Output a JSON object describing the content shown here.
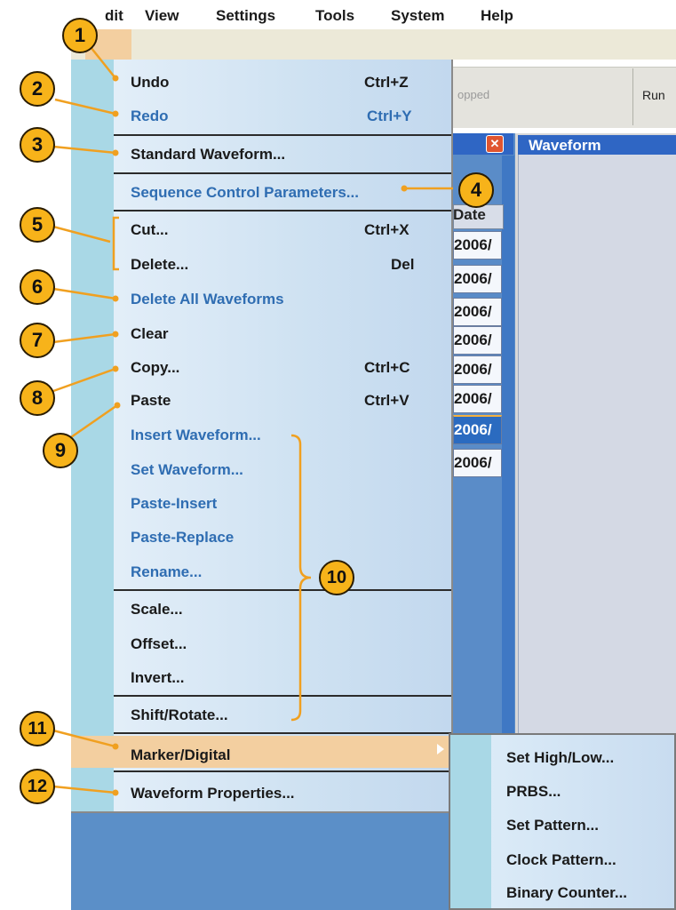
{
  "menubar": {
    "items": [
      {
        "label": "dit"
      },
      {
        "label": "View"
      },
      {
        "label": "Settings"
      },
      {
        "label": "Tools"
      },
      {
        "label": "System"
      },
      {
        "label": "Help"
      }
    ]
  },
  "toolbar": {
    "status_text": "opped",
    "run_label": "Run"
  },
  "list_panel": {
    "header": "Date",
    "rows": [
      "2006/",
      "2006/",
      "2006/",
      "2006/",
      "2006/",
      "2006/",
      "2006/",
      "2006/"
    ],
    "selected_index": 6
  },
  "waveform_panel": {
    "title": "Waveform"
  },
  "edit_menu": {
    "items": [
      {
        "label": "Undo",
        "shortcut": "Ctrl+Z"
      },
      {
        "label": "Redo",
        "shortcut": "Ctrl+Y"
      },
      {
        "label": "Standard Waveform..."
      },
      {
        "label": "Sequence Control Parameters..."
      },
      {
        "label": "Cut...",
        "shortcut": "Ctrl+X"
      },
      {
        "label": "Delete...",
        "shortcut": "Del"
      },
      {
        "label": "Delete All Waveforms"
      },
      {
        "label": "Clear"
      },
      {
        "label": "Copy...",
        "shortcut": "Ctrl+C"
      },
      {
        "label": "Paste",
        "shortcut": "Ctrl+V"
      },
      {
        "label": "Insert Waveform..."
      },
      {
        "label": "Set Waveform..."
      },
      {
        "label": "Paste-Insert"
      },
      {
        "label": "Paste-Replace"
      },
      {
        "label": "Rename..."
      },
      {
        "label": "Scale..."
      },
      {
        "label": "Offset..."
      },
      {
        "label": "Invert..."
      },
      {
        "label": "Shift/Rotate..."
      },
      {
        "label": "Marker/Digital"
      },
      {
        "label": "Waveform Properties..."
      }
    ]
  },
  "submenu": {
    "items": [
      {
        "label": "Set High/Low..."
      },
      {
        "label": "PRBS..."
      },
      {
        "label": "Set Pattern..."
      },
      {
        "label": "Clock Pattern..."
      },
      {
        "label": "Binary Counter..."
      }
    ]
  },
  "callouts": [
    "1",
    "2",
    "3",
    "4",
    "5",
    "6",
    "7",
    "8",
    "9",
    "10",
    "11",
    "12"
  ],
  "colors": {
    "callout_fill": "#f7b31a",
    "callout_line": "#f0a020",
    "highlight": "#f3cfa0",
    "menu_blue_text": "#2f6db2",
    "title_bar": "#2f66c4"
  }
}
